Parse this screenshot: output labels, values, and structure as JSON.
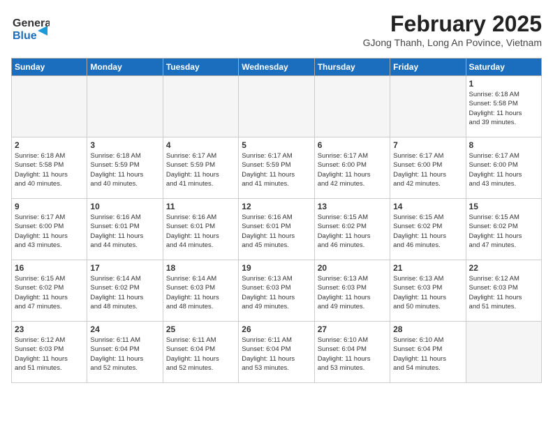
{
  "header": {
    "logo_general": "General",
    "logo_blue": "Blue",
    "title": "February 2025",
    "subtitle": "GJong Thanh, Long An Povince, Vietnam"
  },
  "weekdays": [
    "Sunday",
    "Monday",
    "Tuesday",
    "Wednesday",
    "Thursday",
    "Friday",
    "Saturday"
  ],
  "weeks": [
    [
      {
        "day": "",
        "info": ""
      },
      {
        "day": "",
        "info": ""
      },
      {
        "day": "",
        "info": ""
      },
      {
        "day": "",
        "info": ""
      },
      {
        "day": "",
        "info": ""
      },
      {
        "day": "",
        "info": ""
      },
      {
        "day": "1",
        "info": "Sunrise: 6:18 AM\nSunset: 5:58 PM\nDaylight: 11 hours\nand 39 minutes."
      }
    ],
    [
      {
        "day": "2",
        "info": "Sunrise: 6:18 AM\nSunset: 5:58 PM\nDaylight: 11 hours\nand 40 minutes."
      },
      {
        "day": "3",
        "info": "Sunrise: 6:18 AM\nSunset: 5:59 PM\nDaylight: 11 hours\nand 40 minutes."
      },
      {
        "day": "4",
        "info": "Sunrise: 6:17 AM\nSunset: 5:59 PM\nDaylight: 11 hours\nand 41 minutes."
      },
      {
        "day": "5",
        "info": "Sunrise: 6:17 AM\nSunset: 5:59 PM\nDaylight: 11 hours\nand 41 minutes."
      },
      {
        "day": "6",
        "info": "Sunrise: 6:17 AM\nSunset: 6:00 PM\nDaylight: 11 hours\nand 42 minutes."
      },
      {
        "day": "7",
        "info": "Sunrise: 6:17 AM\nSunset: 6:00 PM\nDaylight: 11 hours\nand 42 minutes."
      },
      {
        "day": "8",
        "info": "Sunrise: 6:17 AM\nSunset: 6:00 PM\nDaylight: 11 hours\nand 43 minutes."
      }
    ],
    [
      {
        "day": "9",
        "info": "Sunrise: 6:17 AM\nSunset: 6:00 PM\nDaylight: 11 hours\nand 43 minutes."
      },
      {
        "day": "10",
        "info": "Sunrise: 6:16 AM\nSunset: 6:01 PM\nDaylight: 11 hours\nand 44 minutes."
      },
      {
        "day": "11",
        "info": "Sunrise: 6:16 AM\nSunset: 6:01 PM\nDaylight: 11 hours\nand 44 minutes."
      },
      {
        "day": "12",
        "info": "Sunrise: 6:16 AM\nSunset: 6:01 PM\nDaylight: 11 hours\nand 45 minutes."
      },
      {
        "day": "13",
        "info": "Sunrise: 6:15 AM\nSunset: 6:02 PM\nDaylight: 11 hours\nand 46 minutes."
      },
      {
        "day": "14",
        "info": "Sunrise: 6:15 AM\nSunset: 6:02 PM\nDaylight: 11 hours\nand 46 minutes."
      },
      {
        "day": "15",
        "info": "Sunrise: 6:15 AM\nSunset: 6:02 PM\nDaylight: 11 hours\nand 47 minutes."
      }
    ],
    [
      {
        "day": "16",
        "info": "Sunrise: 6:15 AM\nSunset: 6:02 PM\nDaylight: 11 hours\nand 47 minutes."
      },
      {
        "day": "17",
        "info": "Sunrise: 6:14 AM\nSunset: 6:02 PM\nDaylight: 11 hours\nand 48 minutes."
      },
      {
        "day": "18",
        "info": "Sunrise: 6:14 AM\nSunset: 6:03 PM\nDaylight: 11 hours\nand 48 minutes."
      },
      {
        "day": "19",
        "info": "Sunrise: 6:13 AM\nSunset: 6:03 PM\nDaylight: 11 hours\nand 49 minutes."
      },
      {
        "day": "20",
        "info": "Sunrise: 6:13 AM\nSunset: 6:03 PM\nDaylight: 11 hours\nand 49 minutes."
      },
      {
        "day": "21",
        "info": "Sunrise: 6:13 AM\nSunset: 6:03 PM\nDaylight: 11 hours\nand 50 minutes."
      },
      {
        "day": "22",
        "info": "Sunrise: 6:12 AM\nSunset: 6:03 PM\nDaylight: 11 hours\nand 51 minutes."
      }
    ],
    [
      {
        "day": "23",
        "info": "Sunrise: 6:12 AM\nSunset: 6:03 PM\nDaylight: 11 hours\nand 51 minutes."
      },
      {
        "day": "24",
        "info": "Sunrise: 6:11 AM\nSunset: 6:04 PM\nDaylight: 11 hours\nand 52 minutes."
      },
      {
        "day": "25",
        "info": "Sunrise: 6:11 AM\nSunset: 6:04 PM\nDaylight: 11 hours\nand 52 minutes."
      },
      {
        "day": "26",
        "info": "Sunrise: 6:11 AM\nSunset: 6:04 PM\nDaylight: 11 hours\nand 53 minutes."
      },
      {
        "day": "27",
        "info": "Sunrise: 6:10 AM\nSunset: 6:04 PM\nDaylight: 11 hours\nand 53 minutes."
      },
      {
        "day": "28",
        "info": "Sunrise: 6:10 AM\nSunset: 6:04 PM\nDaylight: 11 hours\nand 54 minutes."
      },
      {
        "day": "",
        "info": ""
      }
    ]
  ]
}
